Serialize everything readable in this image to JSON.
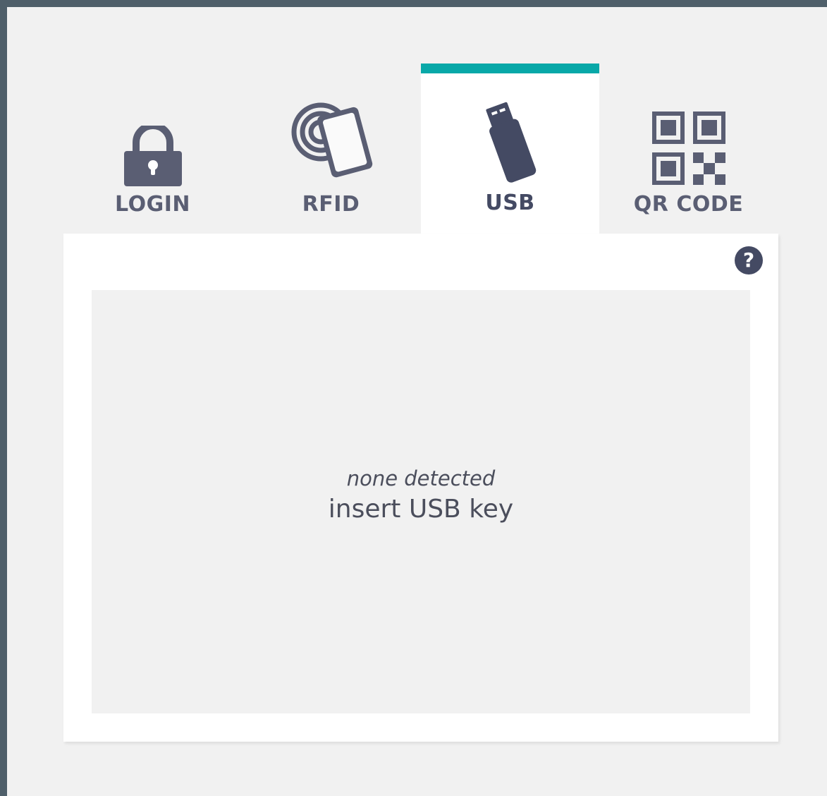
{
  "tabs": [
    {
      "label": "LOGIN",
      "icon": "lock-icon",
      "active": false
    },
    {
      "label": "RFID",
      "icon": "rfid-card-icon",
      "active": false
    },
    {
      "label": "USB",
      "icon": "usb-key-icon",
      "active": true
    },
    {
      "label": "QR CODE",
      "icon": "qr-code-icon",
      "active": false
    }
  ],
  "panel": {
    "help_icon": "question-mark-icon",
    "help_symbol": "?",
    "status": "none detected",
    "instruction": "insert USB key"
  },
  "colors": {
    "accent": "#08a8a8",
    "icon_active": "#444a63",
    "icon_inactive": "#5a5e73",
    "frame": "#4f5f6a",
    "background": "#f1f1f1"
  }
}
